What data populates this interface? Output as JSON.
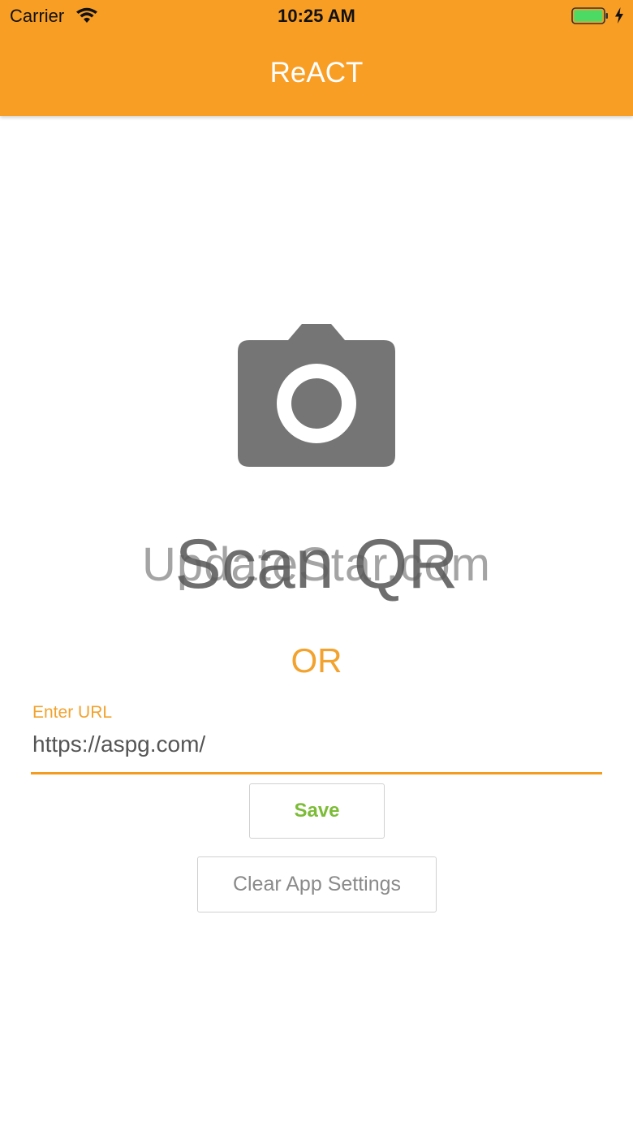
{
  "status_bar": {
    "carrier": "Carrier",
    "time": "10:25 AM"
  },
  "header": {
    "title": "ReACT",
    "background_color": "#f99e25"
  },
  "main": {
    "camera_icon": "camera-icon",
    "scan_label": "Scan QR",
    "watermark": "UpdateStar.com",
    "or_label": "OR",
    "url_field": {
      "label": "Enter URL",
      "value": "https://aspg.com/"
    },
    "save_label": "Save",
    "clear_label": "Clear App Settings"
  },
  "colors": {
    "accent": "#f2a22d",
    "save_text": "#7cbc36",
    "icon_gray": "#757575"
  }
}
